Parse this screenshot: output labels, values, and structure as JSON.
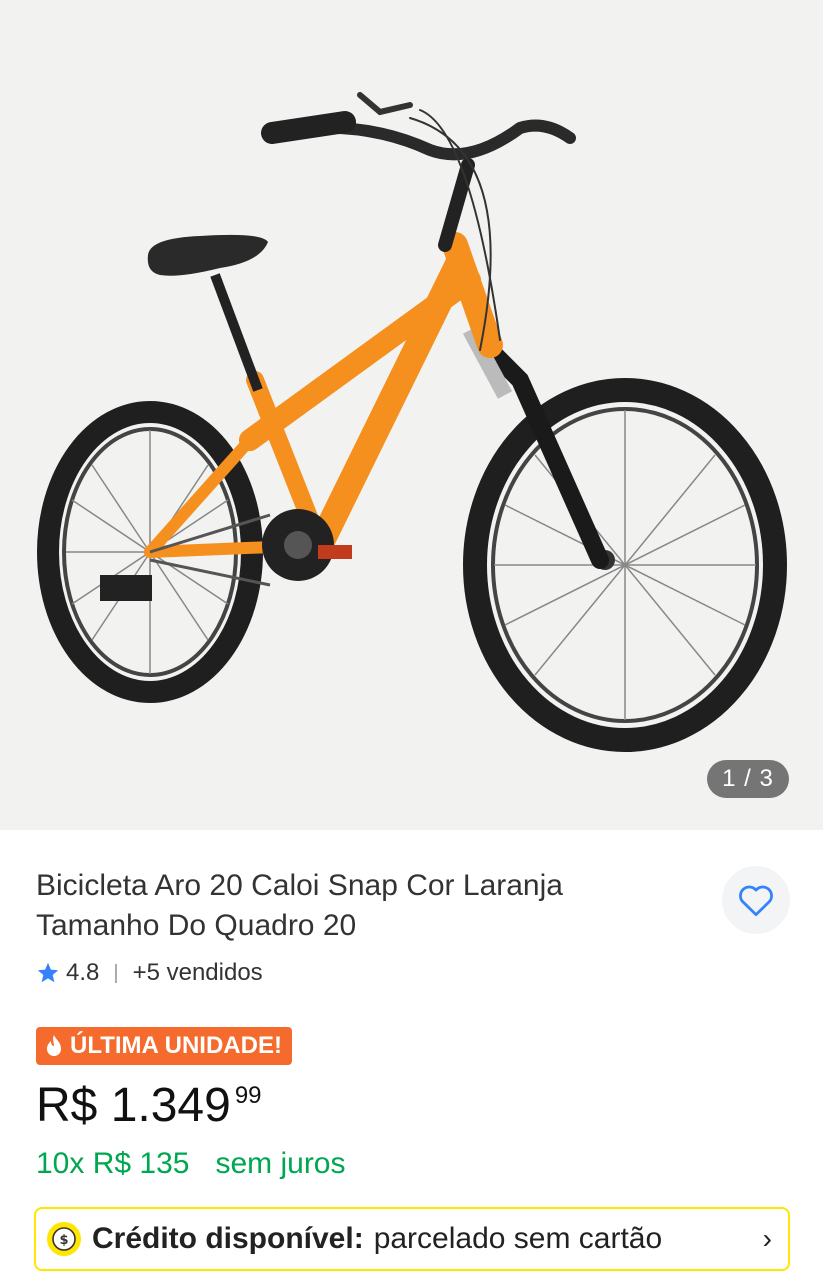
{
  "gallery": {
    "image_alt": "Bicicleta laranja aro 20",
    "counter": "1 / 3"
  },
  "product": {
    "title": "Bicicleta Aro 20 Caloi Snap Cor Laranja Tamanho Do Quadro 20",
    "rating": "4.8",
    "sold": "+5 vendidos",
    "badge": "ÚLTIMA UNIDADE!",
    "price_main": "R$ 1.349",
    "price_cents": "99",
    "installments": "10x R$ 135",
    "installments_note": "sem juros"
  },
  "credit": {
    "label": "Crédito disponível:",
    "text": "parcelado sem cartão",
    "chevron": "›"
  },
  "colors": {
    "accent_orange": "#f46b2d",
    "green": "#00a650",
    "yellow": "#ffe600",
    "blue": "#3483fa"
  },
  "icons": [
    "heart-icon",
    "star-icon",
    "flame-icon",
    "coin-icon",
    "chevron-right-icon"
  ]
}
